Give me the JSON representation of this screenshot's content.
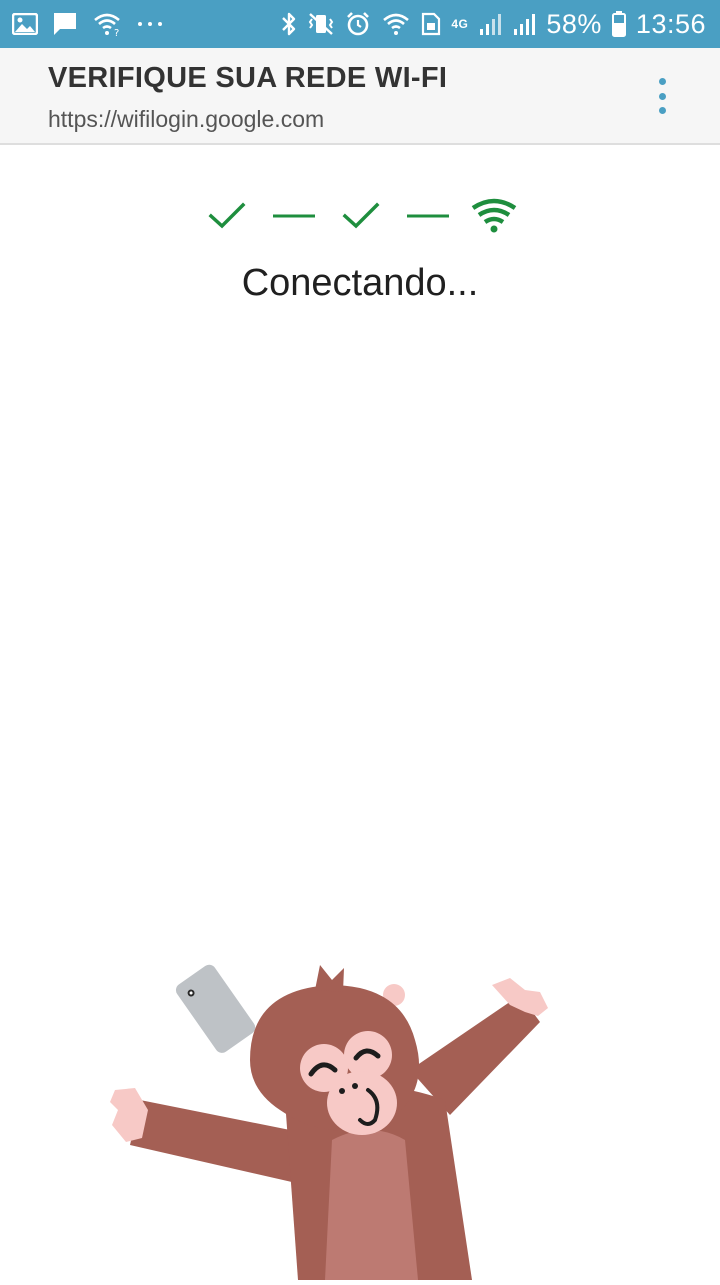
{
  "status_bar": {
    "battery_percent": "58%",
    "time": "13:56",
    "network_type": "4G",
    "notification_icons": [
      "image-icon",
      "message-icon",
      "wifi-question-icon",
      "more-icon"
    ],
    "system_icons": [
      "bluetooth-icon",
      "vibrate-icon",
      "alarm-icon",
      "wifi-icon",
      "sim-icon",
      "signal-icon",
      "signal-icon",
      "battery-icon"
    ],
    "background_color": "#4a9fc3"
  },
  "header": {
    "title": "VERIFIQUE SUA REDE WI-FI",
    "url": "https://wifilogin.google.com",
    "menu_icon": "more-vert-icon"
  },
  "progress": {
    "steps": [
      "check-icon",
      "check-icon",
      "wifi-icon"
    ],
    "color": "#1e8e3e"
  },
  "status_text": "Conectando...",
  "illustration": {
    "icon": "monkey-with-phone-illustration",
    "colors": {
      "fur": "#a45f54",
      "belly": "#bd7a72",
      "face": "#f7c9c6",
      "phone": "#bec2c6"
    }
  }
}
